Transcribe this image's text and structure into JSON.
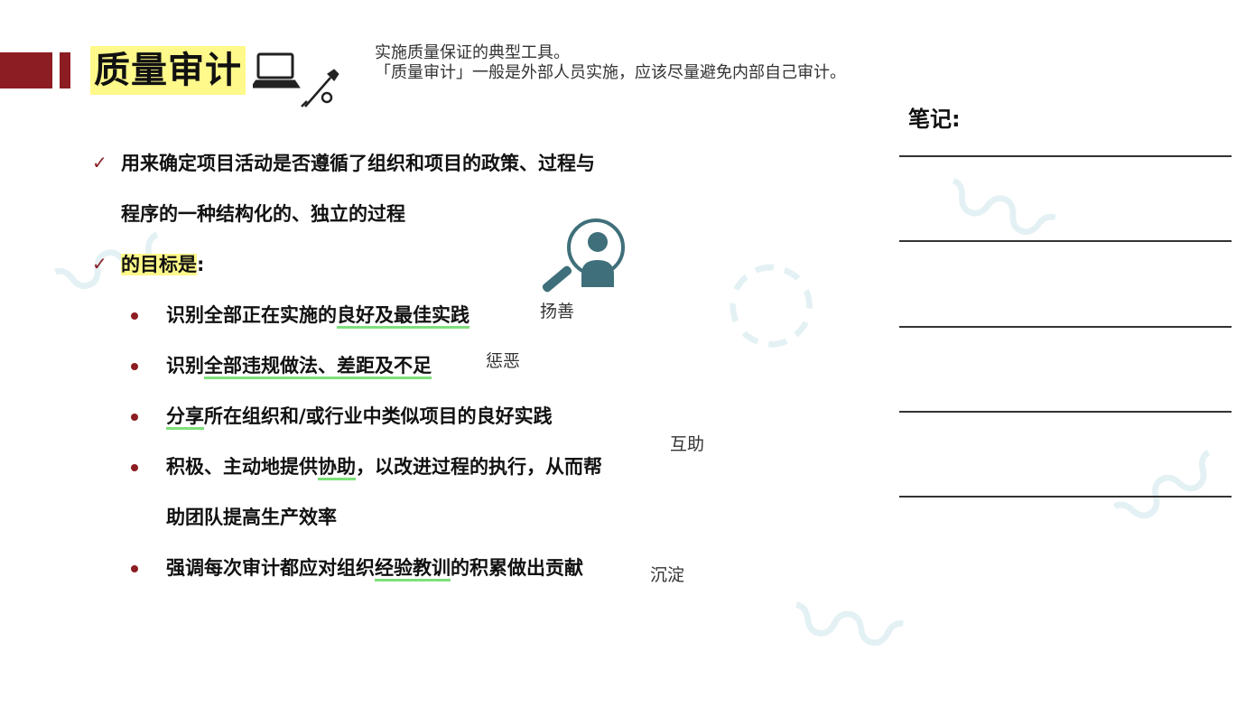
{
  "header": {
    "title": "质量审计",
    "description_lines": [
      "实施质量保证的典型工具。",
      "「质量审计」一般是外部人员实施，应该尽量避免内部自己审计。"
    ]
  },
  "content": {
    "point1_line1": "用来确定项目活动是否遵循了组织和项目的政策、过程与",
    "point1_line2": "程序的一种结构化的、独立的过程",
    "point2_label": "的目标是",
    "point2_colon": ":",
    "goals": [
      {
        "before": "识别全部正在实施的",
        "underlined": "良好及最佳实践",
        "after": ""
      },
      {
        "before": "识别",
        "underlined": "全部违规做法、差距及不足",
        "after": ""
      },
      {
        "before": "",
        "underlined": "分享",
        "after": "所在组织和/或行业中类似项目的良好实践"
      },
      {
        "before": "积极、主动地提供",
        "underlined": "协助",
        "after": "，以改进过程的执行，从而帮",
        "line2": "助团队提高生产效率"
      },
      {
        "before": "强调每次审计都应对组织",
        "underlined": "经验教训",
        "after": "的积累做出贡献"
      }
    ]
  },
  "annotations": {
    "yangshan": "扬善",
    "chenge": "惩恶",
    "huzhu": "互助",
    "chendian": "沉淀"
  },
  "notes": {
    "label": "笔记:"
  },
  "colors": {
    "accent": "#8c1d22",
    "highlight": "#fff88a",
    "underline": "#7ee07a",
    "icon": "#3f6f7a"
  },
  "icons": [
    "laptop-icon",
    "tools-icon",
    "search-user-icon",
    "check-icon"
  ]
}
